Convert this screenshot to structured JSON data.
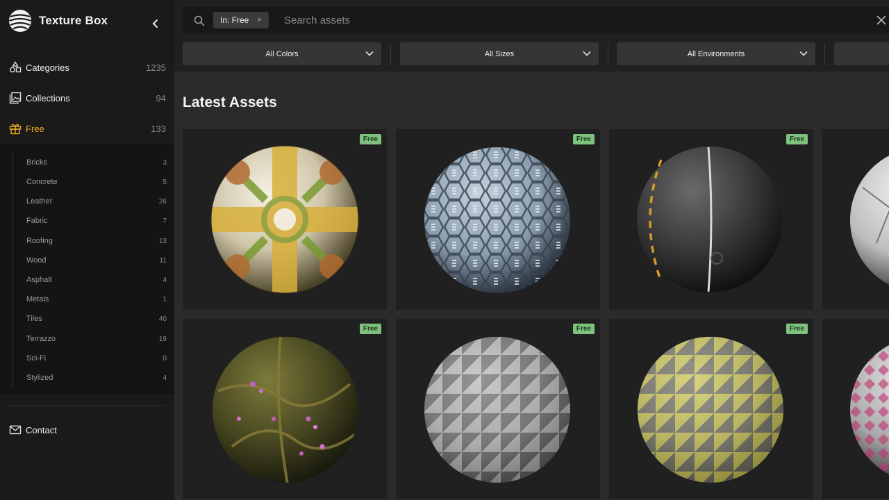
{
  "brand": {
    "name": "Texture Box"
  },
  "nav": [
    {
      "label": "Categories",
      "count": "1235"
    },
    {
      "label": "Collections",
      "count": "94"
    },
    {
      "label": "Free",
      "count": "133"
    }
  ],
  "subnav": [
    {
      "label": "Bricks",
      "count": "3"
    },
    {
      "label": "Concrete",
      "count": "5"
    },
    {
      "label": "Leather",
      "count": "26"
    },
    {
      "label": "Fabric",
      "count": "7"
    },
    {
      "label": "Roofing",
      "count": "13"
    },
    {
      "label": "Wood",
      "count": "11"
    },
    {
      "label": "Asphalt",
      "count": "4"
    },
    {
      "label": "Metals",
      "count": "1"
    },
    {
      "label": "Tiles",
      "count": "40"
    },
    {
      "label": "Terrazzo",
      "count": "19"
    },
    {
      "label": "Sci-Fi",
      "count": "0"
    },
    {
      "label": "Stylized",
      "count": "4"
    }
  ],
  "contact": {
    "label": "Contact"
  },
  "search": {
    "chip": "In: Free",
    "chip_close": "×",
    "placeholder": "Search assets",
    "clear": "✕"
  },
  "filters": [
    "All Colors",
    "All Sizes",
    "All Environments",
    ""
  ],
  "heading": "Latest Assets",
  "assets": [
    {
      "badge": "Free",
      "material": "yellow-ornamental-tiles"
    },
    {
      "badge": "Free",
      "material": "blue-hexagon-tiles"
    },
    {
      "badge": "Free",
      "material": "asphalt-road"
    },
    {
      "badge": "",
      "material": "white-cracked-stone"
    },
    {
      "badge": "Free",
      "material": "mossy-ground-flowers"
    },
    {
      "badge": "Free",
      "material": "gray-triangle-terrazzo"
    },
    {
      "badge": "Free",
      "material": "yellow-gray-triangle-tiles"
    },
    {
      "badge": "",
      "material": "pink-pattern-tiles"
    }
  ],
  "colors": {
    "accent": "#f0b020",
    "badge_bg": "#7ec27e",
    "sidebar_bg": "#1a1a1a",
    "main_bg": "#2b2b2b"
  }
}
